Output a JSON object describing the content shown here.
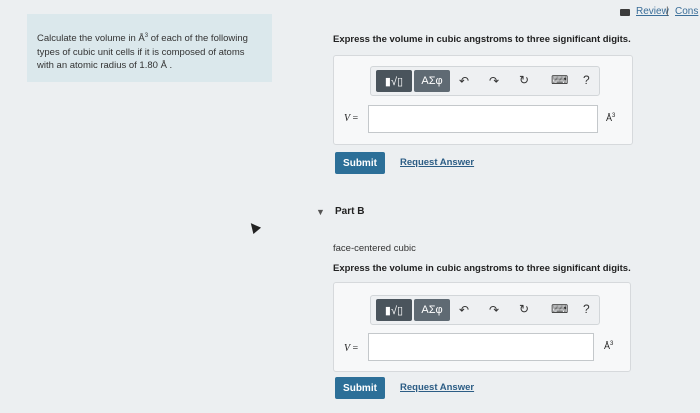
{
  "problem": {
    "line1a": "Calculate the volume in ",
    "line1b": "Å",
    "line1sup": "3",
    "line1c": " of each of the following",
    "line2": "types of cubic unit cells if it is composed of atoms",
    "line3": "with an atomic radius of 1.80 Å ."
  },
  "header": {
    "review": "Review",
    "sep": "|",
    "cons": "Cons"
  },
  "partA": {
    "instruction": "Express the volume in cubic angstroms to three significant digits.",
    "variable": "V",
    "equals": "=",
    "input_value": "",
    "unit": "Å",
    "unit_sup": "3",
    "submit": "Submit",
    "request": "Request Answer"
  },
  "partB": {
    "caret": "▼",
    "label": "Part B",
    "description": "face-centered cubic",
    "instruction": "Express the volume in cubic angstroms to three significant digits.",
    "variable": "V",
    "equals": "=",
    "input_value": "",
    "unit": "Å",
    "unit_sup": "3",
    "submit": "Submit",
    "request": "Request Answer"
  },
  "toolbar": {
    "template_btn": "▮√▯",
    "greek_btn": "ΑΣφ",
    "undo": "↶",
    "redo": "↷",
    "reset": "↻",
    "keyboard": "⌨",
    "help": "?"
  }
}
